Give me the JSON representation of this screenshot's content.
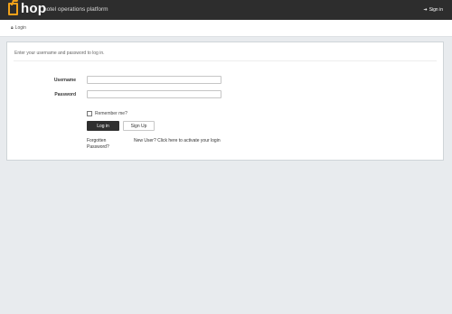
{
  "header": {
    "brand": "hop",
    "tagline": "hotel operations platform",
    "sign_in_label": "Sign in",
    "accent_color": "#f0a11a",
    "background_color": "#2d2d2d"
  },
  "breadcrumb": {
    "label": "Login"
  },
  "login_form": {
    "instruction": "Enter your username and password to log in.",
    "username_label": "Username",
    "username_value": "",
    "password_label": "Password",
    "password_value": "",
    "remember_label": "Remember me?",
    "login_button": "Log in",
    "signup_button": "Sign Up",
    "forgot_link": "Forgotten Password?",
    "new_user_link": "New User? Click here to activate your login"
  }
}
